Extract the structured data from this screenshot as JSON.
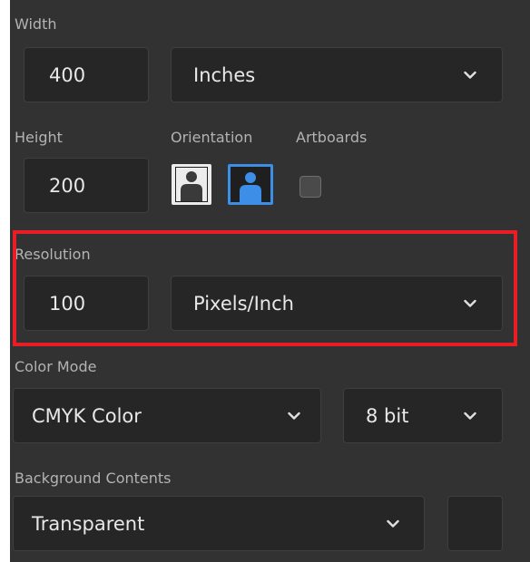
{
  "width": {
    "label": "Width",
    "value": "400",
    "unit": "Inches"
  },
  "height": {
    "label": "Height",
    "value": "200"
  },
  "orientation": {
    "label": "Orientation",
    "icons": [
      "portrait-icon",
      "landscape-icon"
    ],
    "selected": "landscape"
  },
  "artboards": {
    "label": "Artboards",
    "checked": false
  },
  "resolution": {
    "label": "Resolution",
    "value": "100",
    "unit": "Pixels/Inch"
  },
  "color_mode": {
    "label": "Color Mode",
    "mode": "CMYK Color",
    "bit_depth": "8 bit"
  },
  "background": {
    "label": "Background Contents",
    "value": "Transparent"
  },
  "colors": {
    "panel": "#323232",
    "field": "#262626",
    "accent": "#3d8ee6",
    "highlight": "#e81d25"
  }
}
